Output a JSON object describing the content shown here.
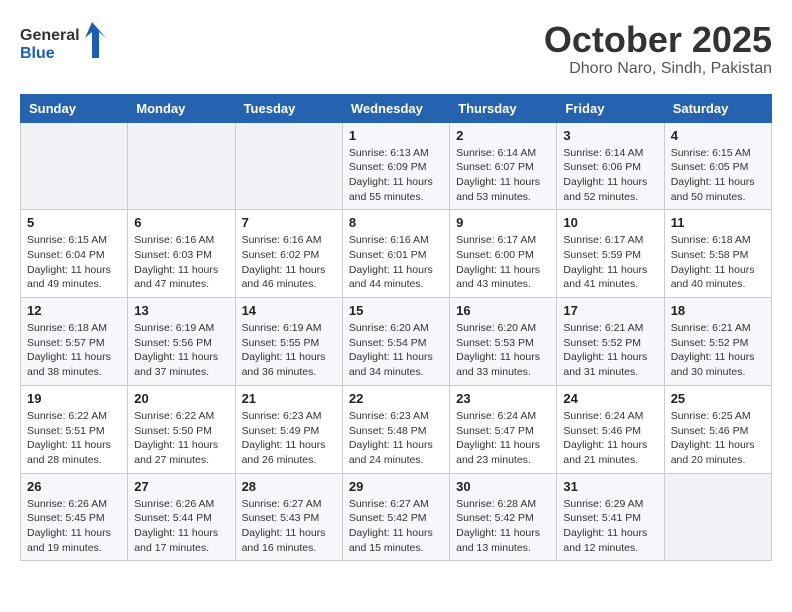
{
  "header": {
    "logo_line1": "General",
    "logo_line2": "Blue",
    "month": "October 2025",
    "location": "Dhoro Naro, Sindh, Pakistan"
  },
  "weekdays": [
    "Sunday",
    "Monday",
    "Tuesday",
    "Wednesday",
    "Thursday",
    "Friday",
    "Saturday"
  ],
  "weeks": [
    [
      {
        "day": "",
        "info": ""
      },
      {
        "day": "",
        "info": ""
      },
      {
        "day": "",
        "info": ""
      },
      {
        "day": "1",
        "info": "Sunrise: 6:13 AM\nSunset: 6:09 PM\nDaylight: 11 hours\nand 55 minutes."
      },
      {
        "day": "2",
        "info": "Sunrise: 6:14 AM\nSunset: 6:07 PM\nDaylight: 11 hours\nand 53 minutes."
      },
      {
        "day": "3",
        "info": "Sunrise: 6:14 AM\nSunset: 6:06 PM\nDaylight: 11 hours\nand 52 minutes."
      },
      {
        "day": "4",
        "info": "Sunrise: 6:15 AM\nSunset: 6:05 PM\nDaylight: 11 hours\nand 50 minutes."
      }
    ],
    [
      {
        "day": "5",
        "info": "Sunrise: 6:15 AM\nSunset: 6:04 PM\nDaylight: 11 hours\nand 49 minutes."
      },
      {
        "day": "6",
        "info": "Sunrise: 6:16 AM\nSunset: 6:03 PM\nDaylight: 11 hours\nand 47 minutes."
      },
      {
        "day": "7",
        "info": "Sunrise: 6:16 AM\nSunset: 6:02 PM\nDaylight: 11 hours\nand 46 minutes."
      },
      {
        "day": "8",
        "info": "Sunrise: 6:16 AM\nSunset: 6:01 PM\nDaylight: 11 hours\nand 44 minutes."
      },
      {
        "day": "9",
        "info": "Sunrise: 6:17 AM\nSunset: 6:00 PM\nDaylight: 11 hours\nand 43 minutes."
      },
      {
        "day": "10",
        "info": "Sunrise: 6:17 AM\nSunset: 5:59 PM\nDaylight: 11 hours\nand 41 minutes."
      },
      {
        "day": "11",
        "info": "Sunrise: 6:18 AM\nSunset: 5:58 PM\nDaylight: 11 hours\nand 40 minutes."
      }
    ],
    [
      {
        "day": "12",
        "info": "Sunrise: 6:18 AM\nSunset: 5:57 PM\nDaylight: 11 hours\nand 38 minutes."
      },
      {
        "day": "13",
        "info": "Sunrise: 6:19 AM\nSunset: 5:56 PM\nDaylight: 11 hours\nand 37 minutes."
      },
      {
        "day": "14",
        "info": "Sunrise: 6:19 AM\nSunset: 5:55 PM\nDaylight: 11 hours\nand 36 minutes."
      },
      {
        "day": "15",
        "info": "Sunrise: 6:20 AM\nSunset: 5:54 PM\nDaylight: 11 hours\nand 34 minutes."
      },
      {
        "day": "16",
        "info": "Sunrise: 6:20 AM\nSunset: 5:53 PM\nDaylight: 11 hours\nand 33 minutes."
      },
      {
        "day": "17",
        "info": "Sunrise: 6:21 AM\nSunset: 5:52 PM\nDaylight: 11 hours\nand 31 minutes."
      },
      {
        "day": "18",
        "info": "Sunrise: 6:21 AM\nSunset: 5:52 PM\nDaylight: 11 hours\nand 30 minutes."
      }
    ],
    [
      {
        "day": "19",
        "info": "Sunrise: 6:22 AM\nSunset: 5:51 PM\nDaylight: 11 hours\nand 28 minutes."
      },
      {
        "day": "20",
        "info": "Sunrise: 6:22 AM\nSunset: 5:50 PM\nDaylight: 11 hours\nand 27 minutes."
      },
      {
        "day": "21",
        "info": "Sunrise: 6:23 AM\nSunset: 5:49 PM\nDaylight: 11 hours\nand 26 minutes."
      },
      {
        "day": "22",
        "info": "Sunrise: 6:23 AM\nSunset: 5:48 PM\nDaylight: 11 hours\nand 24 minutes."
      },
      {
        "day": "23",
        "info": "Sunrise: 6:24 AM\nSunset: 5:47 PM\nDaylight: 11 hours\nand 23 minutes."
      },
      {
        "day": "24",
        "info": "Sunrise: 6:24 AM\nSunset: 5:46 PM\nDaylight: 11 hours\nand 21 minutes."
      },
      {
        "day": "25",
        "info": "Sunrise: 6:25 AM\nSunset: 5:46 PM\nDaylight: 11 hours\nand 20 minutes."
      }
    ],
    [
      {
        "day": "26",
        "info": "Sunrise: 6:26 AM\nSunset: 5:45 PM\nDaylight: 11 hours\nand 19 minutes."
      },
      {
        "day": "27",
        "info": "Sunrise: 6:26 AM\nSunset: 5:44 PM\nDaylight: 11 hours\nand 17 minutes."
      },
      {
        "day": "28",
        "info": "Sunrise: 6:27 AM\nSunset: 5:43 PM\nDaylight: 11 hours\nand 16 minutes."
      },
      {
        "day": "29",
        "info": "Sunrise: 6:27 AM\nSunset: 5:42 PM\nDaylight: 11 hours\nand 15 minutes."
      },
      {
        "day": "30",
        "info": "Sunrise: 6:28 AM\nSunset: 5:42 PM\nDaylight: 11 hours\nand 13 minutes."
      },
      {
        "day": "31",
        "info": "Sunrise: 6:29 AM\nSunset: 5:41 PM\nDaylight: 11 hours\nand 12 minutes."
      },
      {
        "day": "",
        "info": ""
      }
    ]
  ]
}
